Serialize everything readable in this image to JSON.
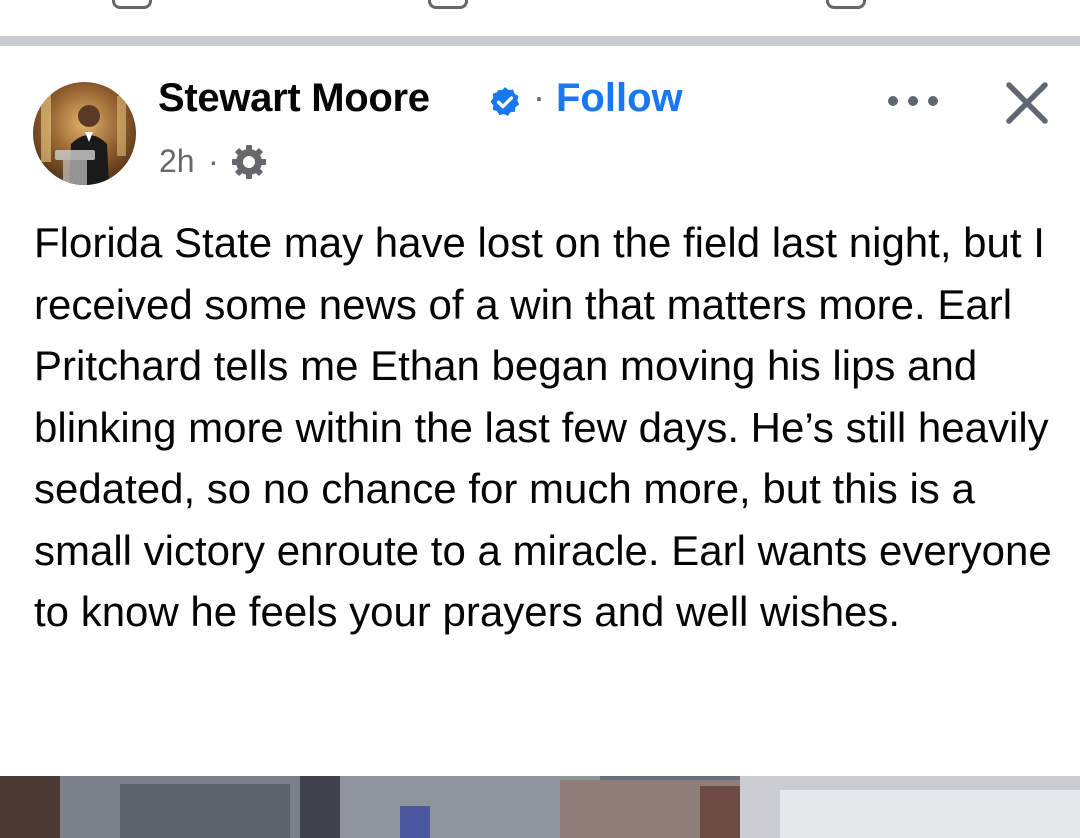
{
  "post": {
    "author": {
      "name": "Stewart Moore",
      "verified": true,
      "follow_label": "Follow",
      "separator": "·"
    },
    "meta": {
      "time": "2h",
      "separator": "·",
      "audience_icon": "gear-icon"
    },
    "actions": {
      "more_icon": "more-horizontal-icon",
      "close_icon": "close-icon"
    },
    "text": "Florida State may have lost on the field last night, but I received some news of a win that matters more. Earl Pritchard tells me Ethan began moving his lips and blinking more within the last few days. He’s still heavily sedated, so no chance for much more, but this is a small victory enroute to a miracle. Earl wants everyone to know he feels your prayers and well wishes."
  },
  "colors": {
    "link": "#1877f2",
    "secondary_text": "#65676b",
    "separator": "#c9ccd1"
  }
}
